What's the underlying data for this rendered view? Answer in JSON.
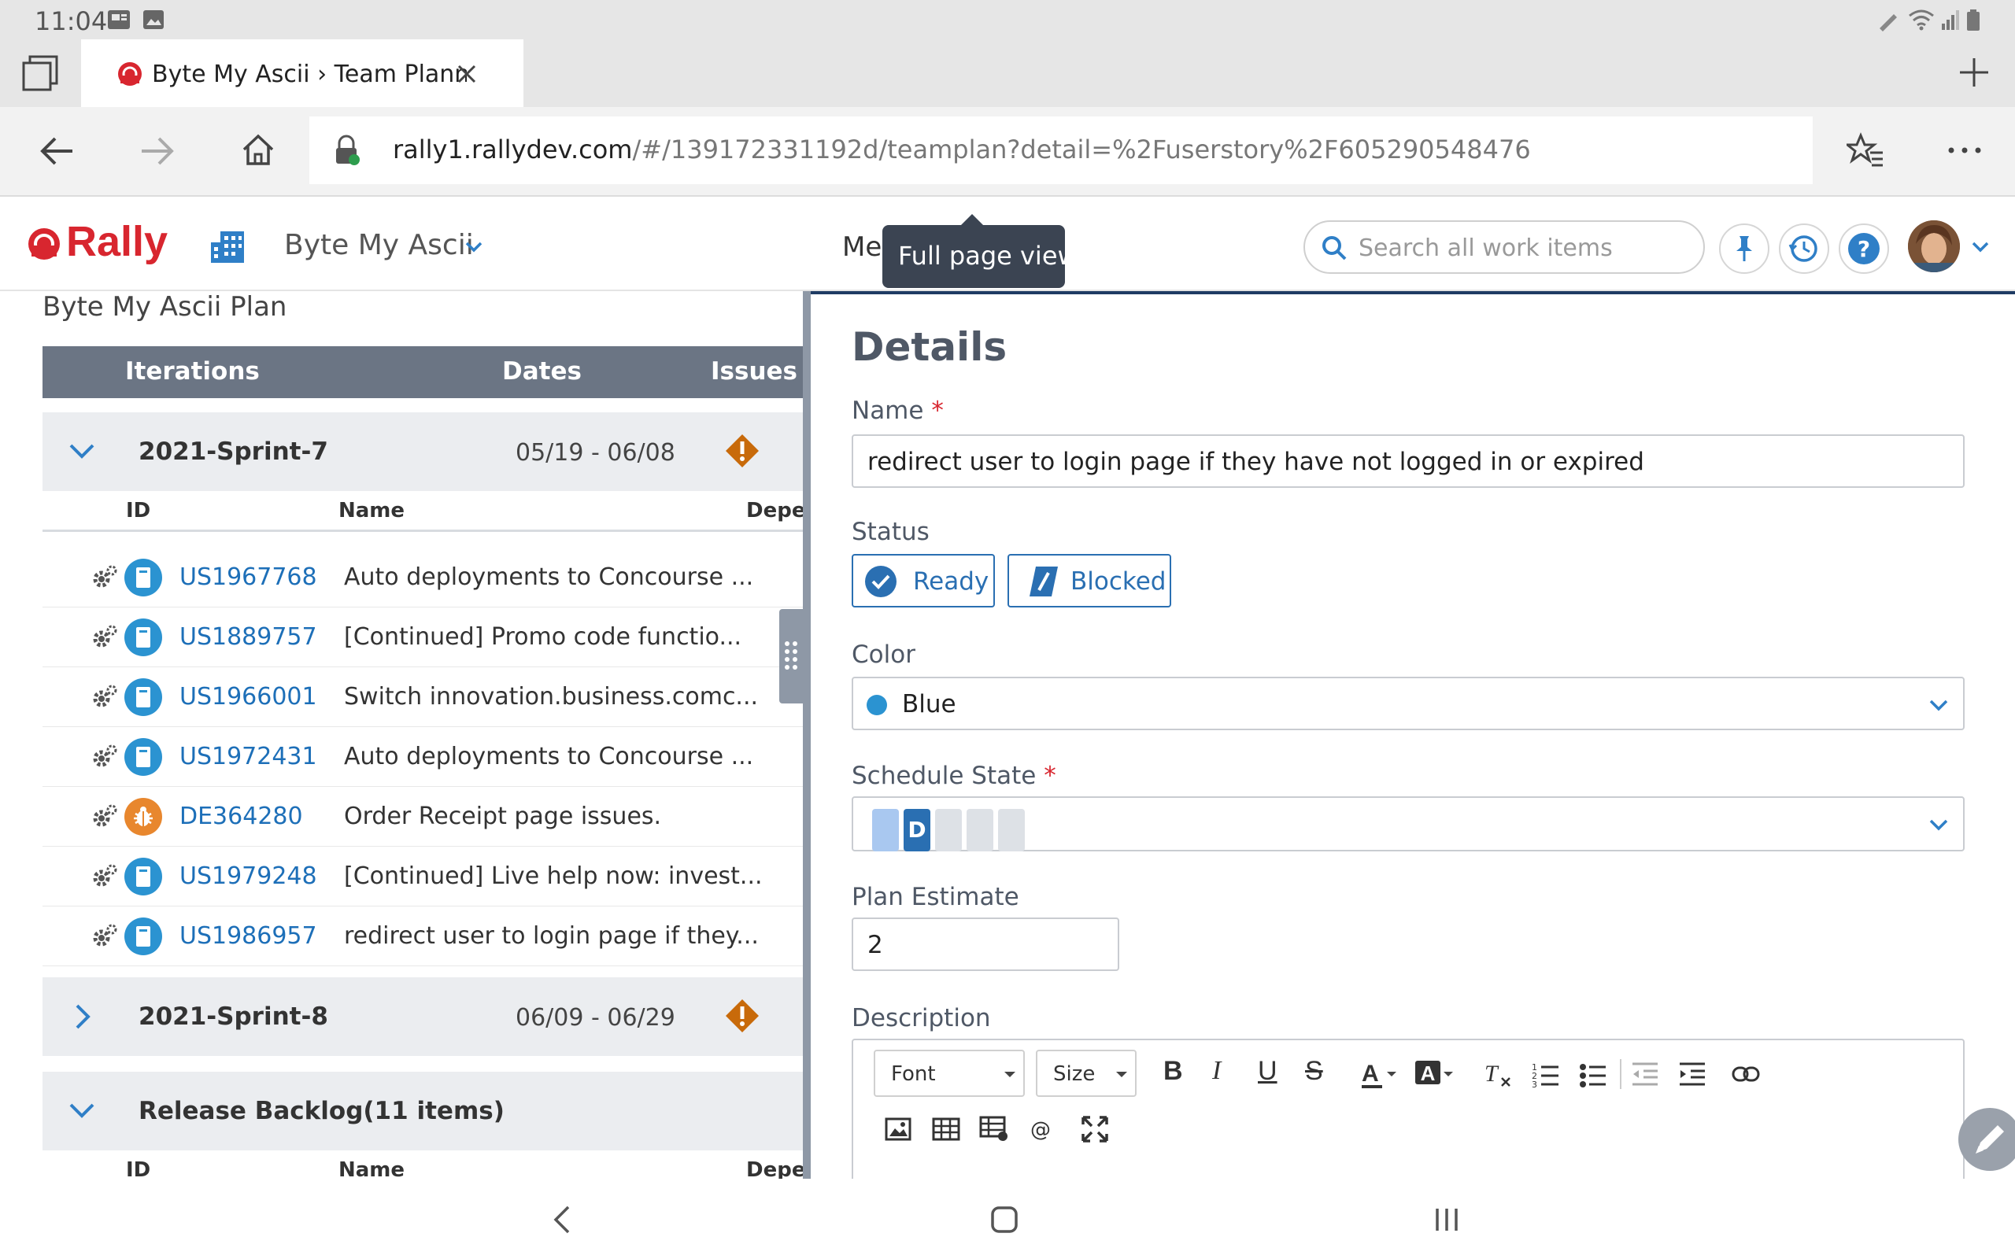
{
  "status_bar": {
    "time": "11:04"
  },
  "browser": {
    "tab_title": "Byte My Ascii › Team Plannin",
    "url_host": "rally1.rallydev.com",
    "url_path": "/#/139172331192d/teamplan?detail=%2Fuserstory%2F605290548476"
  },
  "header": {
    "logo": "Rally",
    "project": "Byte My Ascii",
    "menu_text": "Me",
    "tooltip": "Full page view",
    "search_placeholder": "Search all work items"
  },
  "left": {
    "plan_title": "Byte My Ascii Plan",
    "columns": {
      "iterations": "Iterations",
      "dates": "Dates",
      "issues": "Issues"
    },
    "sub_columns": {
      "id": "ID",
      "name": "Name",
      "deps": "Deper"
    },
    "sprints": [
      {
        "name": "2021-Sprint-7",
        "dates": "05/19 - 06/08"
      },
      {
        "name": "2021-Sprint-8",
        "dates": "06/09 - 06/29"
      },
      {
        "name": "Release Backlog(11 items)",
        "dates": ""
      }
    ],
    "stories": [
      {
        "id": "US1967768",
        "name": "Auto deployments to Concourse ...",
        "type": "story"
      },
      {
        "id": "US1889757",
        "name": "[Continued] Promo code functio...",
        "type": "story"
      },
      {
        "id": "US1966001",
        "name": "Switch innovation.business.comc...",
        "type": "story"
      },
      {
        "id": "US1972431",
        "name": "Auto deployments to Concourse ...",
        "type": "story"
      },
      {
        "id": "DE364280",
        "name": "Order Receipt page issues.",
        "type": "defect"
      },
      {
        "id": "US1979248",
        "name": "[Continued] Live help now: invest...",
        "type": "story"
      },
      {
        "id": "US1986957",
        "name": "redirect user to login page if they...",
        "type": "story"
      }
    ]
  },
  "details": {
    "title": "Details",
    "name_label": "Name",
    "required_mark": "*",
    "name_value": "redirect user to login page if they have not logged in or expired",
    "status_label": "Status",
    "status_ready": "Ready",
    "status_blocked": "Blocked",
    "color_label": "Color",
    "color_value": "Blue",
    "schedule_label": "Schedule State",
    "schedule_current": "D",
    "plan_label": "Plan Estimate",
    "plan_value": "2",
    "description_label": "Description",
    "font_select": "Font",
    "size_select": "Size"
  },
  "colors": {
    "accent": "#2a6fb2",
    "story_badge": "#2b93d1",
    "defect_badge": "#e8872e",
    "warning": "#c86a0a",
    "brand": "#d8262f"
  }
}
